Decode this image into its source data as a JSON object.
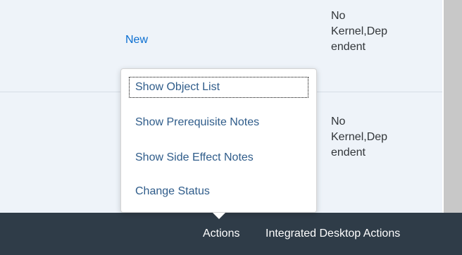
{
  "table": {
    "rows": [
      {
        "status": "New",
        "type_lines": [
          "No",
          "Kernel,Dep",
          "endent"
        ]
      },
      {
        "status": "",
        "type_lines": [
          "No",
          "Kernel,Dep",
          "endent"
        ]
      }
    ]
  },
  "menu": {
    "items": [
      {
        "label": "Show Object List",
        "focused": true
      },
      {
        "label": "Show Prerequisite Notes"
      },
      {
        "label": "Show Side Effect Notes"
      },
      {
        "label": "Change Status"
      }
    ]
  },
  "footer": {
    "actions_label": "Actions",
    "integrated_label": "Integrated Desktop Actions"
  },
  "colors": {
    "row_background": "#eef3f9",
    "footer_background": "#2f3c48",
    "link": "#0a6ed1",
    "menu_text": "#2f5c8a",
    "text": "#32363a",
    "scrollbar": "#c8c8c8"
  }
}
